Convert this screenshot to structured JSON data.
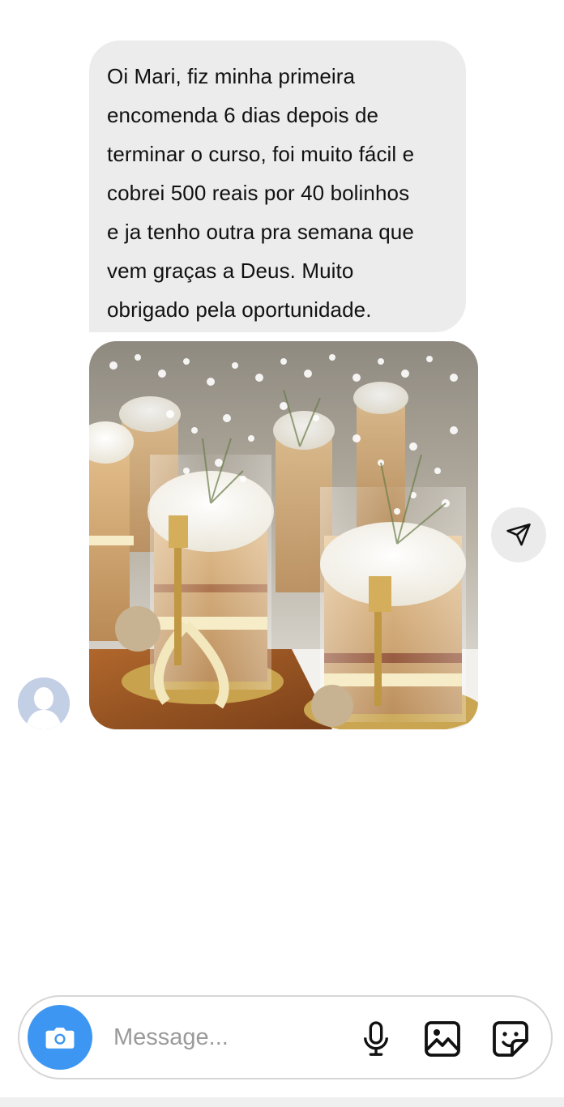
{
  "chat": {
    "message": {
      "text": "Oi Mari, fiz minha primeira\nencomenda 6 dias depois de\nterminar o curso, foi muito fácil e\ncobrei 500 reais por 40 bolinhos\ne ja tenho outra pra semana que\nvem graças a Deus. Muito\nobrigado pela oportunidade."
    },
    "photo": {
      "alt": "cake-jars-photo"
    },
    "share_icon": "paper-plane-icon",
    "avatar_icon": "default-avatar-icon"
  },
  "composer": {
    "placeholder": "Message...",
    "icons": {
      "camera": "camera-icon",
      "mic": "microphone-icon",
      "gallery": "image-icon",
      "sticker": "sticker-icon"
    },
    "accent_color": "#3d96f2"
  }
}
